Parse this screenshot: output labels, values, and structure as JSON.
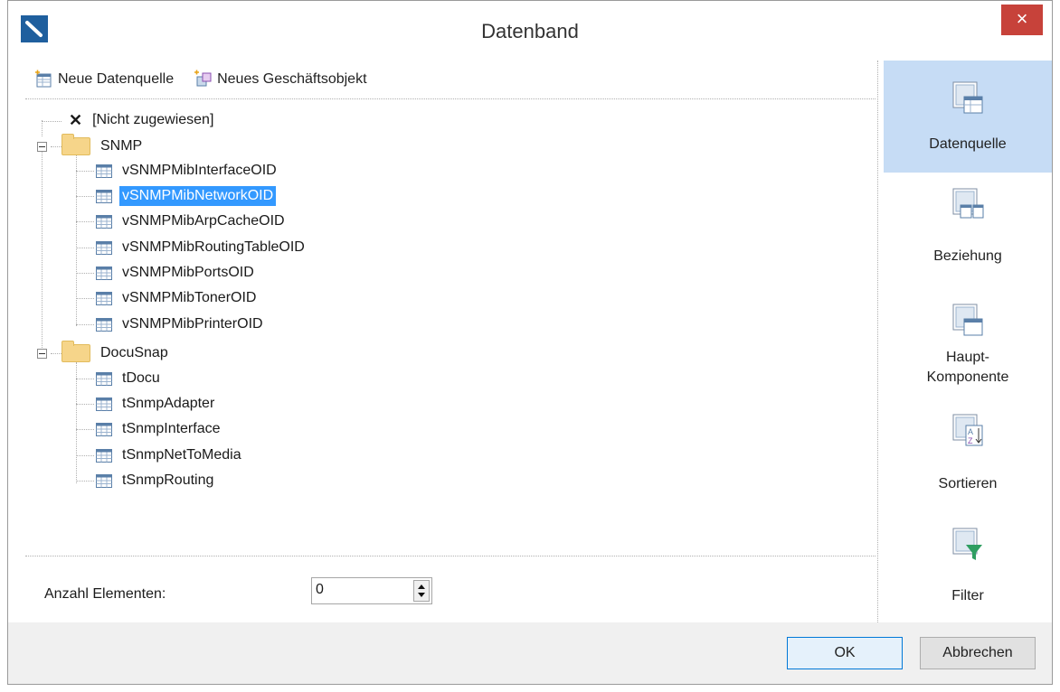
{
  "window": {
    "title": "Datenband",
    "close_glyph": "×"
  },
  "toolbar": {
    "new_datasource_label": "Neue Datenquelle",
    "new_business_object_label": "Neues Geschäftsobjekt"
  },
  "tree": {
    "unassigned_label": "[Nicht zugewiesen]",
    "groups": [
      {
        "label": "SNMP",
        "items": [
          "vSNMPMibInterfaceOID",
          "vSNMPMibNetworkOID",
          "vSNMPMibArpCacheOID",
          "vSNMPMibRoutingTableOID",
          "vSNMPMibPortsOID",
          "vSNMPMibTonerOID",
          "vSNMPMibPrinterOID"
        ]
      },
      {
        "label": "DocuSnap",
        "items": [
          "tDocu",
          "tSnmpAdapter",
          "tSnmpInterface",
          "tSnmpNetToMedia",
          "tSnmpRouting"
        ]
      }
    ],
    "selected_item": "vSNMPMibNetworkOID"
  },
  "count": {
    "label": "Anzahl Elementen:",
    "value": "0"
  },
  "side_panel": {
    "items": [
      {
        "label": "Datenquelle",
        "icon": "datasource-icon",
        "active": true
      },
      {
        "label": "Beziehung",
        "icon": "relation-icon",
        "active": false
      },
      {
        "label": "Haupt-\nKomponente",
        "icon": "master-component-icon",
        "active": false
      },
      {
        "label": "Sortieren",
        "icon": "sort-icon",
        "active": false
      },
      {
        "label": "Filter",
        "icon": "filter-icon",
        "active": false
      }
    ]
  },
  "buttons": {
    "ok_label": "OK",
    "cancel_label": "Abbrechen"
  },
  "colors": {
    "selection": "#3399ff",
    "active_side_item": "#c6dcf5",
    "close_button": "#c7423a"
  }
}
